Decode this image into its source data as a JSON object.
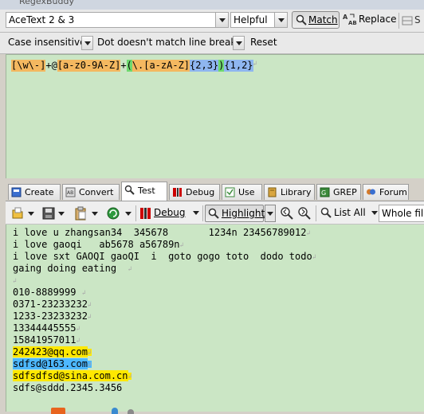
{
  "window": {
    "title": "RegexBuddy"
  },
  "top": {
    "flavor": "AceText 2 & 3",
    "helpful": "Helpful",
    "match": "Match",
    "replace": "Replace"
  },
  "options": {
    "case": "Case insensitive",
    "dot": "Dot doesn't match line breaks",
    "reset": "Reset"
  },
  "regex": {
    "tokens": [
      {
        "text": "[\\w\\-]",
        "bg": "#f4b860"
      },
      {
        "text": "+",
        "bg": "#cbe6c5"
      },
      {
        "text": "@",
        "bg": "#cbe6c5"
      },
      {
        "text": "[a-z0-9A-Z]",
        "bg": "#f4b860"
      },
      {
        "text": "+",
        "bg": "#cbe6c5"
      },
      {
        "text": "(",
        "bg": "#6fd96f"
      },
      {
        "text": "\\.",
        "bg": "#f4b860"
      },
      {
        "text": "[a-zA-Z]",
        "bg": "#f4b860"
      },
      {
        "text": "{2,3}",
        "bg": "#8fb6f0"
      },
      {
        "text": ")",
        "bg": "#6fd96f"
      },
      {
        "text": "{1,2}",
        "bg": "#8fb6f0"
      }
    ]
  },
  "tabs": [
    {
      "label": "Create"
    },
    {
      "label": "Convert"
    },
    {
      "label": "Test"
    },
    {
      "label": "Debug"
    },
    {
      "label": "Use"
    },
    {
      "label": "Library"
    },
    {
      "label": "GREP"
    },
    {
      "label": "Forum"
    }
  ],
  "toolbar": {
    "debug": "Debug",
    "highlight": "Highlight",
    "list_all": "List All",
    "whole_file": "Whole file"
  },
  "test_lines": [
    {
      "text": "i love u zhangsan34  345678       1234n 23456789012",
      "hl": ""
    },
    {
      "text": "i love gaoqi   ab5678 a56789n",
      "hl": ""
    },
    {
      "text": "i love sxt GAOQI gaoQI  i  goto gogo toto  dodo todo",
      "hl": ""
    },
    {
      "text": "gaing doing eating  ",
      "hl": ""
    },
    {
      "text": "",
      "hl": ""
    },
    {
      "text": "010-8889999 ",
      "hl": ""
    },
    {
      "text": "0371-23233232",
      "hl": ""
    },
    {
      "text": "1233-23233232",
      "hl": ""
    },
    {
      "text": "13344445555",
      "hl": ""
    },
    {
      "text": "15841957011",
      "hl": ""
    },
    {
      "text": "242423@qq.com",
      "hl": "y"
    },
    {
      "text": "sdfsd@163.com",
      "hl": "b"
    },
    {
      "text": "sdfsdfsd@sina.com.cn",
      "hl": "y"
    },
    {
      "text": "sdfs@sddd.2345.3456",
      "hl": ""
    }
  ]
}
